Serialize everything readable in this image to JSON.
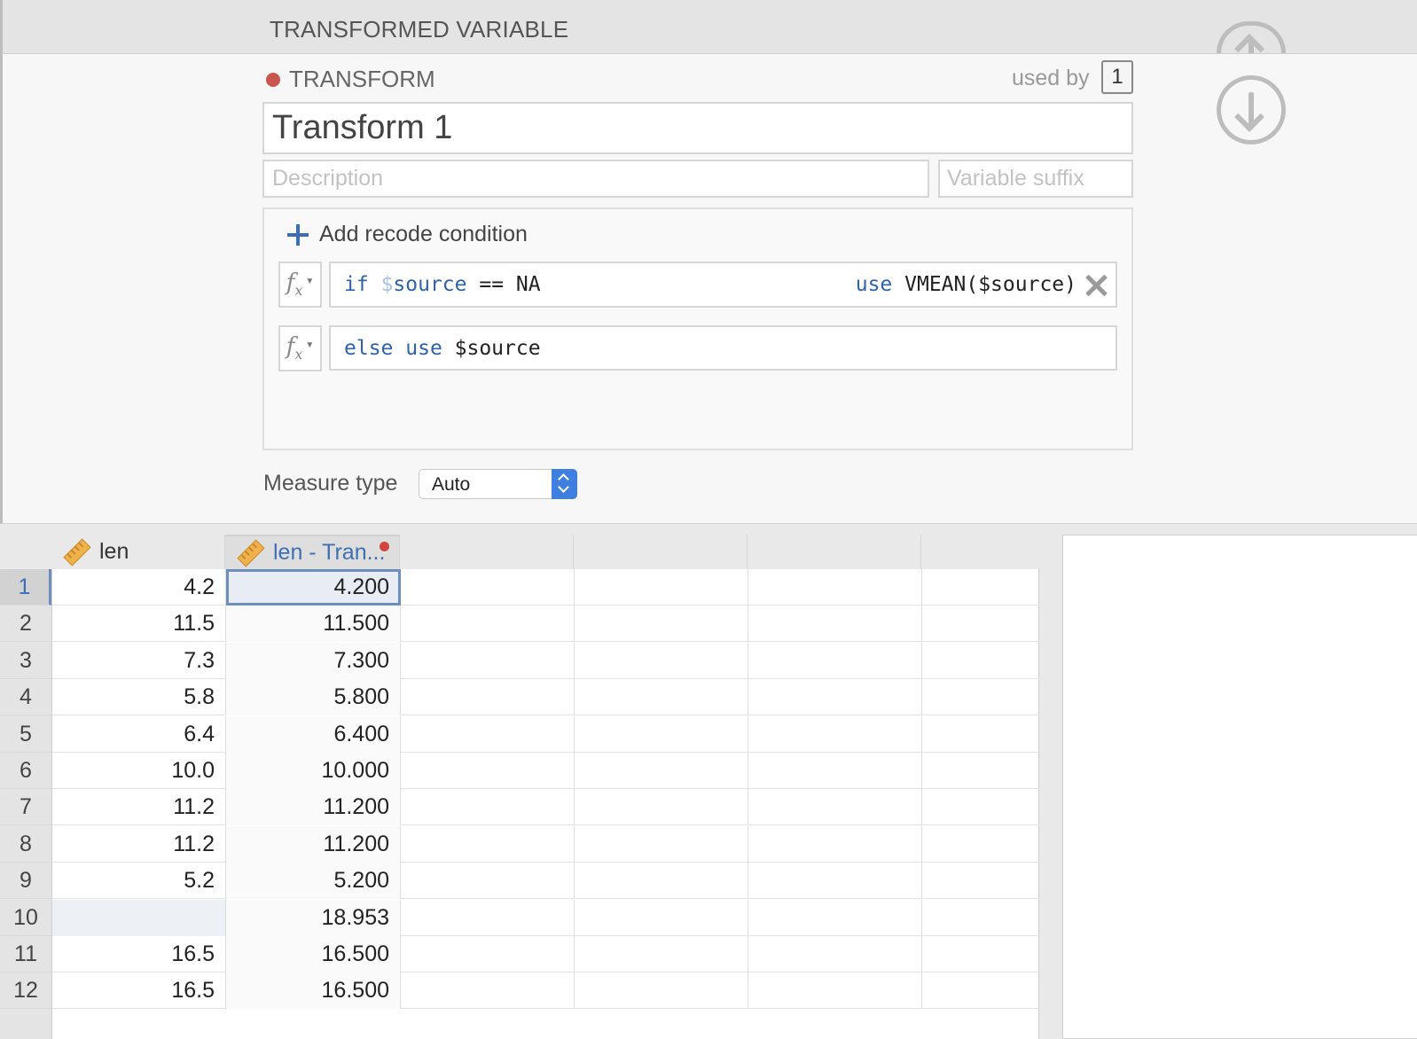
{
  "window": {
    "section_header": "TRANSFORMED VARIABLE"
  },
  "transform": {
    "label": "TRANSFORM",
    "dot_color": "#c9574f",
    "used_by_label": "used by",
    "used_by_count": "1",
    "name": "Transform 1",
    "description_placeholder": "Description",
    "suffix_placeholder": "Variable suffix",
    "add_condition_label": "Add recode condition",
    "conditions": [
      {
        "if_kw": "if",
        "var_sigil": "$",
        "var_name": "source",
        "operator_tail": " == NA",
        "use_kw": "use",
        "use_expr": " VMEAN($source)"
      }
    ],
    "else_rule": {
      "else_kw": "else",
      "use_kw": "use",
      "expr": " $source"
    },
    "measure_type_label": "Measure type",
    "measure_type_value": "Auto"
  },
  "spreadsheet": {
    "columns": [
      {
        "label": "len",
        "icon": "ruler-icon"
      },
      {
        "label": "len - Tran...",
        "icon": "ruler-icon",
        "modified": true
      }
    ],
    "rows": [
      {
        "num": "1",
        "len": "4.2",
        "transformed": "4.200"
      },
      {
        "num": "2",
        "len": "11.5",
        "transformed": "11.500"
      },
      {
        "num": "3",
        "len": "7.3",
        "transformed": "7.300"
      },
      {
        "num": "4",
        "len": "5.8",
        "transformed": "5.800"
      },
      {
        "num": "5",
        "len": "6.4",
        "transformed": "6.400"
      },
      {
        "num": "6",
        "len": "10.0",
        "transformed": "10.000"
      },
      {
        "num": "7",
        "len": "11.2",
        "transformed": "11.200"
      },
      {
        "num": "8",
        "len": "11.2",
        "transformed": "11.200"
      },
      {
        "num": "9",
        "len": "5.2",
        "transformed": "5.200"
      },
      {
        "num": "10",
        "len": "",
        "transformed": "18.953"
      },
      {
        "num": "11",
        "len": "16.5",
        "transformed": "16.500"
      },
      {
        "num": "12",
        "len": "16.5",
        "transformed": "16.500"
      }
    ]
  }
}
